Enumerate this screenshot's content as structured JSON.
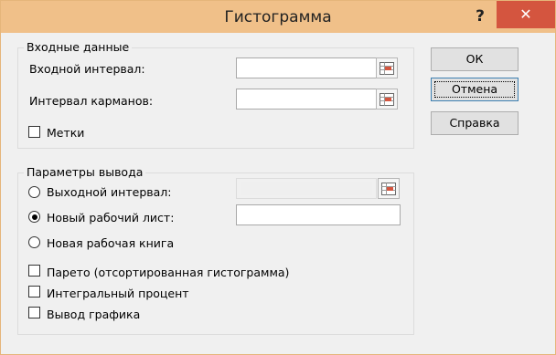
{
  "window": {
    "title": "Гистограмма",
    "help_label": "?",
    "close_label": "✕"
  },
  "input_group": {
    "title": "Входные данные",
    "input_range_label": "Входной интервал:",
    "input_range_value": "",
    "bin_range_label": "Интервал карманов:",
    "bin_range_value": "",
    "labels_checkbox": "Метки",
    "labels_checked": false
  },
  "output_group": {
    "title": "Параметры вывода",
    "output_range_label": "Выходной интервал:",
    "new_sheet_label": "Новый рабочий лист:",
    "new_sheet_value": "",
    "new_workbook_label": "Новая рабочая книга",
    "selected_option": "new_sheet",
    "pareto_label": "Парето (отсортированная гистограмма)",
    "cumulative_label": "Интегральный процент",
    "chart_output_label": "Вывод графика"
  },
  "buttons": {
    "ok": "ОК",
    "cancel": "Отмена",
    "help": "Справка"
  },
  "icons": {
    "ref_icon": "range-select-icon",
    "accent": "#d4553f",
    "titlebar": "#f0c089"
  }
}
